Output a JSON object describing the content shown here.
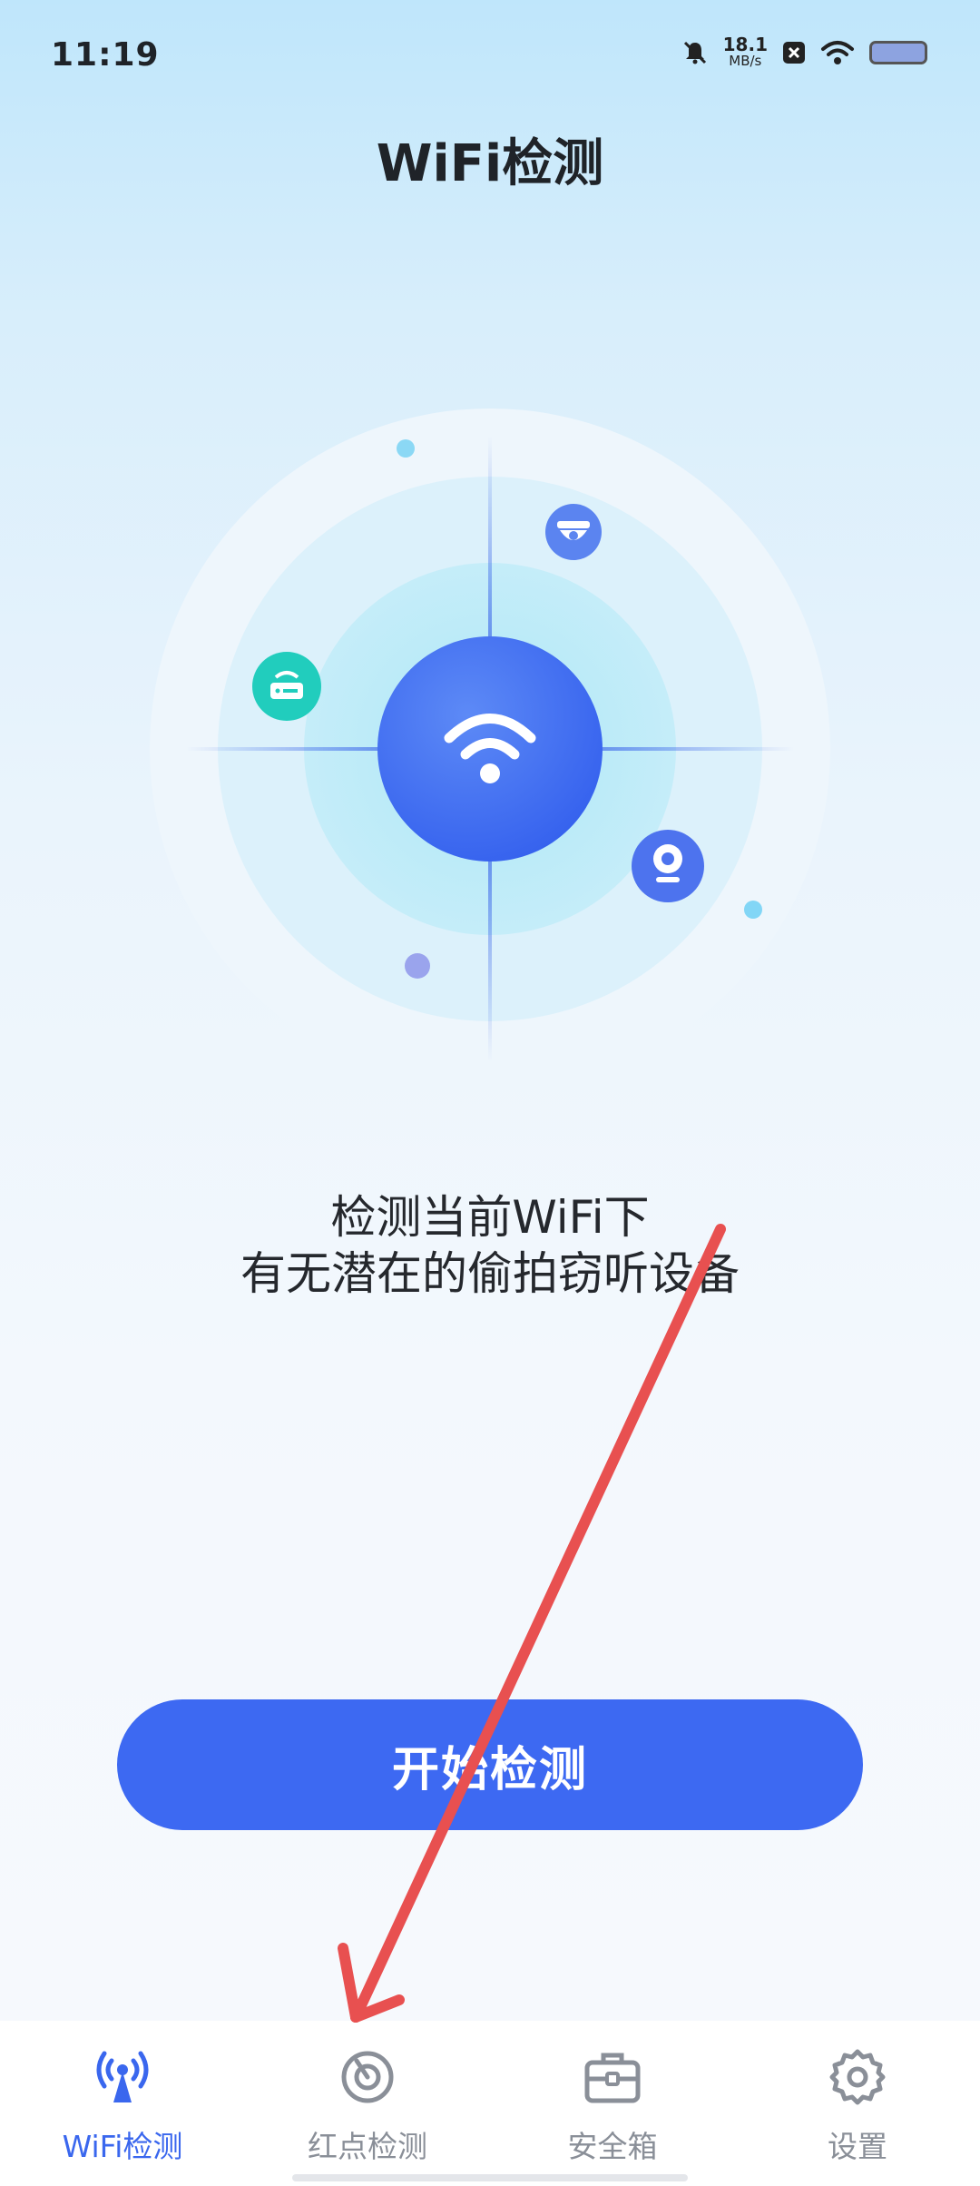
{
  "status_bar": {
    "time": "11:19",
    "net_speed_value": "18.1",
    "net_speed_unit": "MB/s",
    "icons": [
      "bell-muted-icon",
      "close-box-icon",
      "wifi-icon",
      "battery-icon"
    ]
  },
  "header": {
    "title": "WiFi检测"
  },
  "main": {
    "description_line1": "检测当前WiFi下",
    "description_line2": "有无潜在的偷拍窃听设备",
    "start_button_label": "开始检测",
    "radar_icons": [
      "wifi-icon",
      "camera-dome-icon",
      "router-icon",
      "webcam-icon"
    ]
  },
  "bottom_nav": {
    "items": [
      {
        "label": "WiFi检测",
        "icon": "signal-tower-icon",
        "active": true
      },
      {
        "label": "红点检测",
        "icon": "target-icon",
        "active": false
      },
      {
        "label": "安全箱",
        "icon": "toolbox-icon",
        "active": false
      },
      {
        "label": "设置",
        "icon": "gear-icon",
        "active": false
      }
    ]
  },
  "colors": {
    "accent": "#3d69f2",
    "active_nav": "#3a67ee",
    "inactive_nav": "#8a8f98",
    "annotation_arrow": "#e85050"
  }
}
